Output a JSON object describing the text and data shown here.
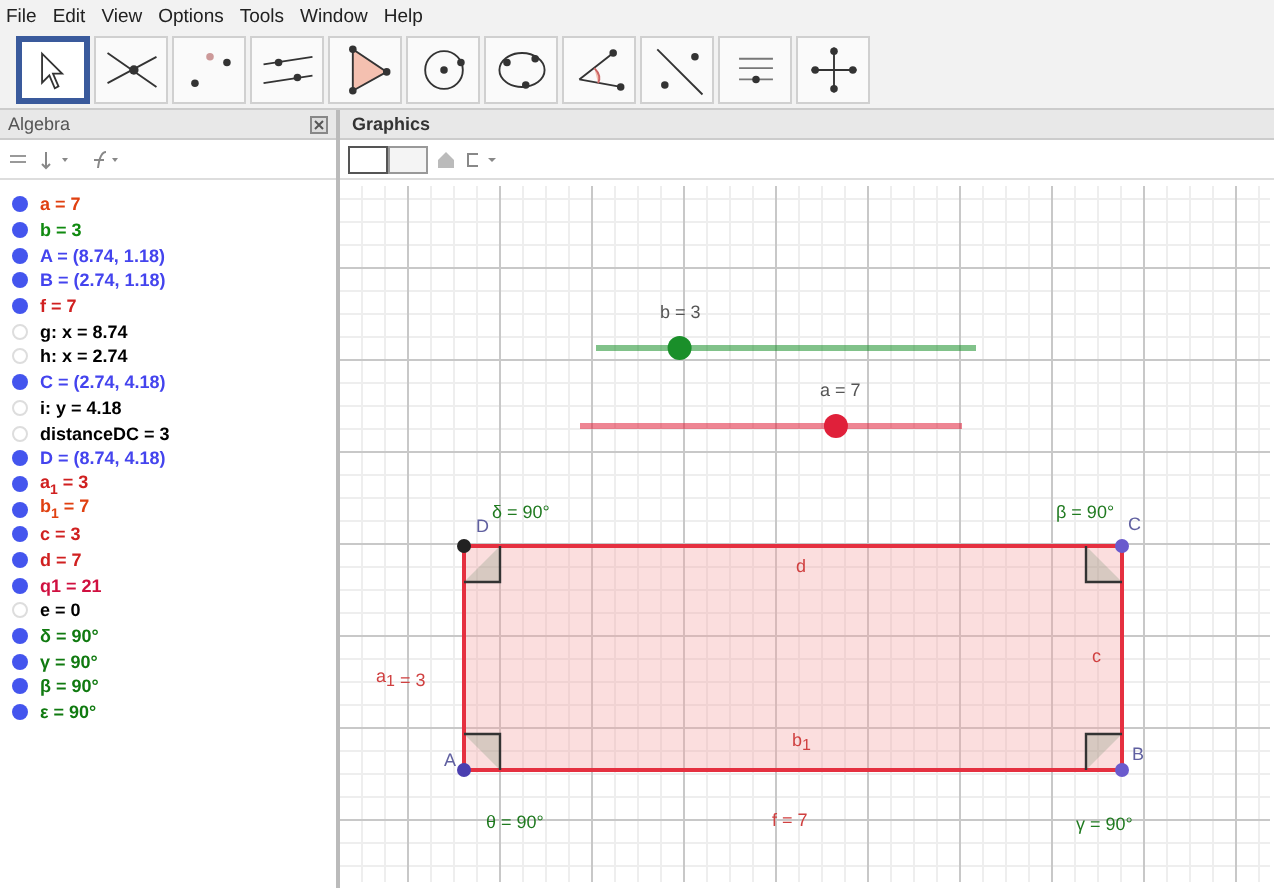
{
  "menu": [
    "File",
    "Edit",
    "View",
    "Options",
    "Tools",
    "Window",
    "Help"
  ],
  "toolbar": [
    {
      "selected": true
    },
    {
      "selected": false
    },
    {
      "selected": false
    },
    {
      "selected": false
    },
    {
      "selected": false
    },
    {
      "selected": false
    },
    {
      "selected": false
    },
    {
      "selected": false
    },
    {
      "selected": false
    },
    {
      "selected": false
    },
    {
      "selected": false
    }
  ],
  "algebra": {
    "title": "Algebra",
    "items": [
      {
        "text": "a = 7",
        "visible": true,
        "color": "#e04010"
      },
      {
        "text": "b = 3",
        "visible": true,
        "color": "#108a10"
      },
      {
        "text": "A = (8.74, 1.18)",
        "visible": true,
        "color": "#4444ee"
      },
      {
        "text": "B = (2.74, 1.18)",
        "visible": true,
        "color": "#4444ee"
      },
      {
        "text": "f = 7",
        "visible": true,
        "color": "#d02020"
      },
      {
        "text": "g: x = 8.74",
        "visible": false,
        "color": "#000000"
      },
      {
        "text": "h: x = 2.74",
        "visible": false,
        "color": "#000000"
      },
      {
        "text": "C = (2.74, 4.18)",
        "visible": true,
        "color": "#4444ee"
      },
      {
        "text": "i: y = 4.18",
        "visible": false,
        "color": "#000000"
      },
      {
        "text": "distanceDC = 3",
        "visible": false,
        "color": "#000000"
      },
      {
        "text": "D = (8.74, 4.18)",
        "visible": true,
        "color": "#4444ee"
      },
      {
        "text": "a$_{1}$ = 3",
        "visible": true,
        "color": "#d02020"
      },
      {
        "text": "b$_{1}$ = 7",
        "visible": true,
        "color": "#e04010"
      },
      {
        "text": "c = 3",
        "visible": true,
        "color": "#d02020"
      },
      {
        "text": "d = 7",
        "visible": true,
        "color": "#d02020"
      },
      {
        "text": "q1 = 21",
        "visible": true,
        "color": "#d01040"
      },
      {
        "text": "e = 0",
        "visible": false,
        "color": "#000000"
      },
      {
        "text": "δ = 90°",
        "visible": true,
        "color": "#107a10"
      },
      {
        "text": "γ = 90°",
        "visible": true,
        "color": "#107a10"
      },
      {
        "text": "β = 90°",
        "visible": true,
        "color": "#107a10"
      },
      {
        "text": "ε = 90°",
        "visible": true,
        "color": "#107a10"
      }
    ]
  },
  "graphics": {
    "title": "Graphics",
    "sliders": [
      {
        "label": "b = 3",
        "color": "#1a8f2a",
        "level": 0.22
      },
      {
        "label": "a = 7",
        "color": "#e0203a",
        "level": 0.67
      }
    ],
    "points": [
      {
        "label": "D",
        "color": "#222222"
      },
      {
        "label": "C",
        "color": "#6a5acd"
      },
      {
        "label": "A",
        "color": "#4b3fb0"
      },
      {
        "label": "B",
        "color": "#6a5acd"
      }
    ],
    "labels": [
      {
        "kind": "angle",
        "text": "δ = 90°"
      },
      {
        "kind": "angle",
        "text": "β = 90°"
      },
      {
        "kind": "angle",
        "text": "θ = 90°"
      },
      {
        "kind": "angle",
        "text": "γ = 90°"
      },
      {
        "kind": "segment",
        "text": "d"
      },
      {
        "kind": "segment",
        "text": "c"
      },
      {
        "kind": "segment",
        "text": "b$_{1}$"
      },
      {
        "kind": "segment",
        "text": "f = 7"
      },
      {
        "kind": "segment",
        "text": "a$_{1}$ = 3"
      }
    ]
  }
}
